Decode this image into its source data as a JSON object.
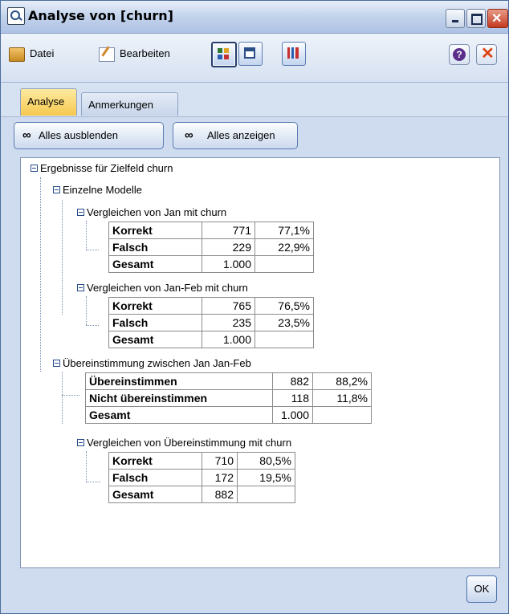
{
  "window": {
    "title": "Analyse von [churn]",
    "controls": {
      "minimize_icon": "minimize-icon",
      "maximize_icon": "maximize-icon",
      "close_icon": "close-icon"
    }
  },
  "toolbar": {
    "file_label": "Datei",
    "edit_label": "Bearbeiten",
    "icons": [
      "table-view-icon",
      "print-icon",
      "chart-export-icon"
    ],
    "help_icon": "help-icon",
    "close_icon": "close-icon"
  },
  "tabs": [
    {
      "label": "Analyse",
      "active": true
    },
    {
      "label": "Anmerkungen",
      "active": false
    }
  ],
  "actions": {
    "collapse_all": "Alles ausblenden",
    "expand_all": "Alles anzeigen"
  },
  "tree": {
    "root": "Ergebnisse für Zielfeld churn",
    "individual_models": "Einzelne Modelle",
    "compare1": {
      "label": "Vergleichen von Jan mit churn",
      "rows": [
        {
          "label": "Korrekt",
          "count": "771",
          "pct": "77,1%"
        },
        {
          "label": "Falsch",
          "count": "229",
          "pct": "22,9%"
        },
        {
          "label": "Gesamt",
          "count": "1.000",
          "pct": ""
        }
      ]
    },
    "compare2": {
      "label": "Vergleichen von Jan-Feb mit churn",
      "rows": [
        {
          "label": "Korrekt",
          "count": "765",
          "pct": "76,5%"
        },
        {
          "label": "Falsch",
          "count": "235",
          "pct": "23,5%"
        },
        {
          "label": "Gesamt",
          "count": "1.000",
          "pct": ""
        }
      ]
    },
    "agreement": {
      "label": "Übereinstimmung zwischen  Jan Jan-Feb",
      "rows": [
        {
          "label": "Übereinstimmen",
          "count": "882",
          "pct": "88,2%"
        },
        {
          "label": "Nicht übereinstimmen",
          "count": "118",
          "pct": "11,8%"
        },
        {
          "label": "Gesamt",
          "count": "1.000",
          "pct": ""
        }
      ]
    },
    "compare3": {
      "label": "Vergleichen von Übereinstimmung mit churn",
      "rows": [
        {
          "label": "Korrekt",
          "count": "710",
          "pct": "80,5%"
        },
        {
          "label": "Falsch",
          "count": "172",
          "pct": "19,5%"
        },
        {
          "label": "Gesamt",
          "count": "882",
          "pct": ""
        }
      ]
    }
  },
  "ok_label": "OK"
}
